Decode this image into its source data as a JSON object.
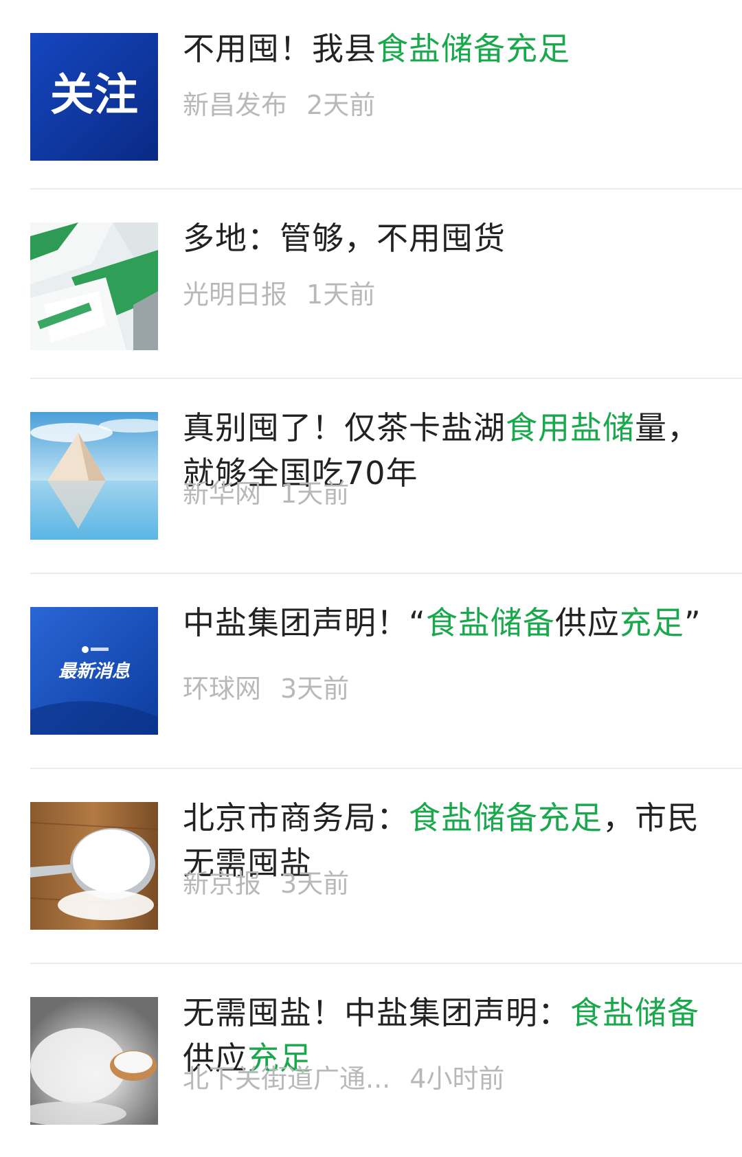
{
  "articles": [
    {
      "thumb_icon": "follow-banner-image",
      "thumb_text": "关注",
      "title_parts": [
        {
          "text": "不用囤！我县",
          "hl": false
        },
        {
          "text": "食盐储备充足",
          "hl": true
        }
      ],
      "source": "新昌发布",
      "time": "2天前"
    },
    {
      "thumb_icon": "salt-packages-image",
      "title_parts": [
        {
          "text": "多地：管够，不用囤货",
          "hl": false
        }
      ],
      "source": "光明日报",
      "time": "1天前"
    },
    {
      "thumb_icon": "salt-lake-pyramid-image",
      "title_parts": [
        {
          "text": "真别囤了！仅茶卡盐湖",
          "hl": false
        },
        {
          "text": "食用盐储",
          "hl": true
        },
        {
          "text": "量，就够全国吃70年",
          "hl": false
        }
      ],
      "source": "新华网",
      "time": "1天前"
    },
    {
      "thumb_icon": "latest-news-banner-image",
      "thumb_text": "最新消息",
      "title_parts": [
        {
          "text": "中盐集团声明！“",
          "hl": false
        },
        {
          "text": "食盐储备",
          "hl": true
        },
        {
          "text": "供应",
          "hl": false
        },
        {
          "text": "充足",
          "hl": true
        },
        {
          "text": "”",
          "hl": false
        }
      ],
      "source": "环球网",
      "time": "3天前"
    },
    {
      "thumb_icon": "salt-spoon-image",
      "title_parts": [
        {
          "text": "北京市商务局：",
          "hl": false
        },
        {
          "text": "食盐储备充足",
          "hl": true
        },
        {
          "text": "，市民无需囤盐",
          "hl": false
        }
      ],
      "source": "新京报",
      "time": "3天前"
    },
    {
      "thumb_icon": "salt-pile-bowl-image",
      "title_parts": [
        {
          "text": "无需囤盐！中盐集团声明：",
          "hl": false
        },
        {
          "text": "食盐储备",
          "hl": true
        },
        {
          "text": "供应",
          "hl": false
        },
        {
          "text": "充足",
          "hl": true
        }
      ],
      "source": "北下关街道广通...",
      "time": "4小时前"
    }
  ],
  "colors": {
    "highlight": "#19a84c",
    "title": "#222222",
    "meta": "#b8b8b8"
  }
}
